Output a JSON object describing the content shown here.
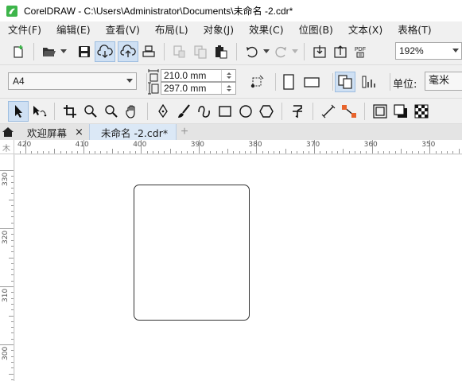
{
  "window": {
    "title": "CorelDRAW - C:\\Users\\Administrator\\Documents\\未命名 -2.cdr*"
  },
  "menu": {
    "items": [
      "文件(F)",
      "编辑(E)",
      "查看(V)",
      "布局(L)",
      "对象(J)",
      "效果(C)",
      "位图(B)",
      "文本(X)",
      "表格(T)"
    ]
  },
  "toolbar": {
    "zoom_value": "192%"
  },
  "property_bar": {
    "page_size": "A4",
    "width": "210.0 mm",
    "height": "297.0 mm",
    "units_label": "单位:",
    "units_value": "毫米"
  },
  "tabs": {
    "welcome_label": "欢迎屏幕",
    "welcome_close": "×",
    "doc_label": "未命名 -2.cdr*",
    "add_label": "+"
  },
  "rulers": {
    "horizontal_labels": [
      "420",
      "410",
      "400",
      "390",
      "380",
      "370",
      "360",
      "350"
    ],
    "vertical_labels": [
      "330",
      "320",
      "310",
      "300"
    ],
    "corner_glyph": "木"
  },
  "colors": {
    "accent": "#2b7fd4",
    "app_icon_green": "#3db54a",
    "active_tab": "#dbe8f6"
  }
}
